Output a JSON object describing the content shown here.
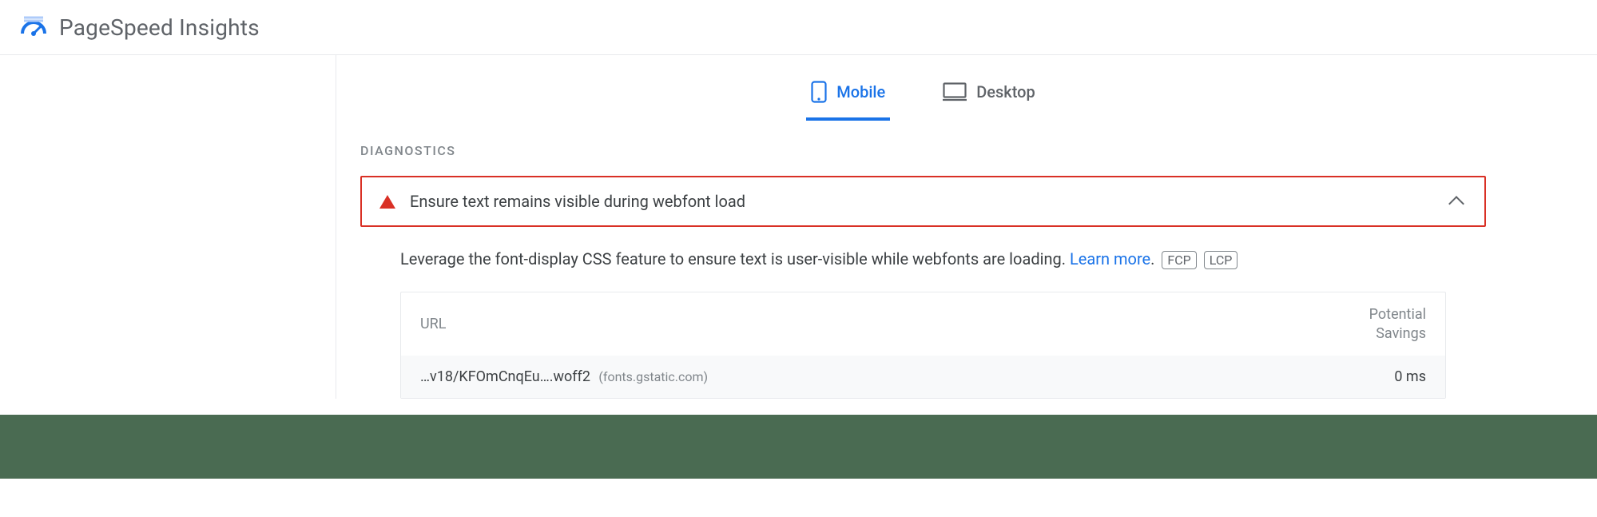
{
  "header": {
    "title": "PageSpeed Insights"
  },
  "tabs": {
    "mobile": "Mobile",
    "desktop": "Desktop"
  },
  "section": {
    "title": "DIAGNOSTICS"
  },
  "audit": {
    "title": "Ensure text remains visible during webfont load",
    "description_pre": "Leverage the font-display CSS feature to ensure text is user-visible while webfonts are loading. ",
    "learn_more": "Learn more",
    "period": ".",
    "badge_fcp": "FCP",
    "badge_lcp": "LCP"
  },
  "table": {
    "headers": {
      "url": "URL",
      "savings_line1": "Potential",
      "savings_line2": "Savings"
    },
    "rows": [
      {
        "url": "…v18/KFOmCnqEu….woff2",
        "origin": "(fonts.gstatic.com)",
        "savings": "0 ms"
      }
    ]
  }
}
